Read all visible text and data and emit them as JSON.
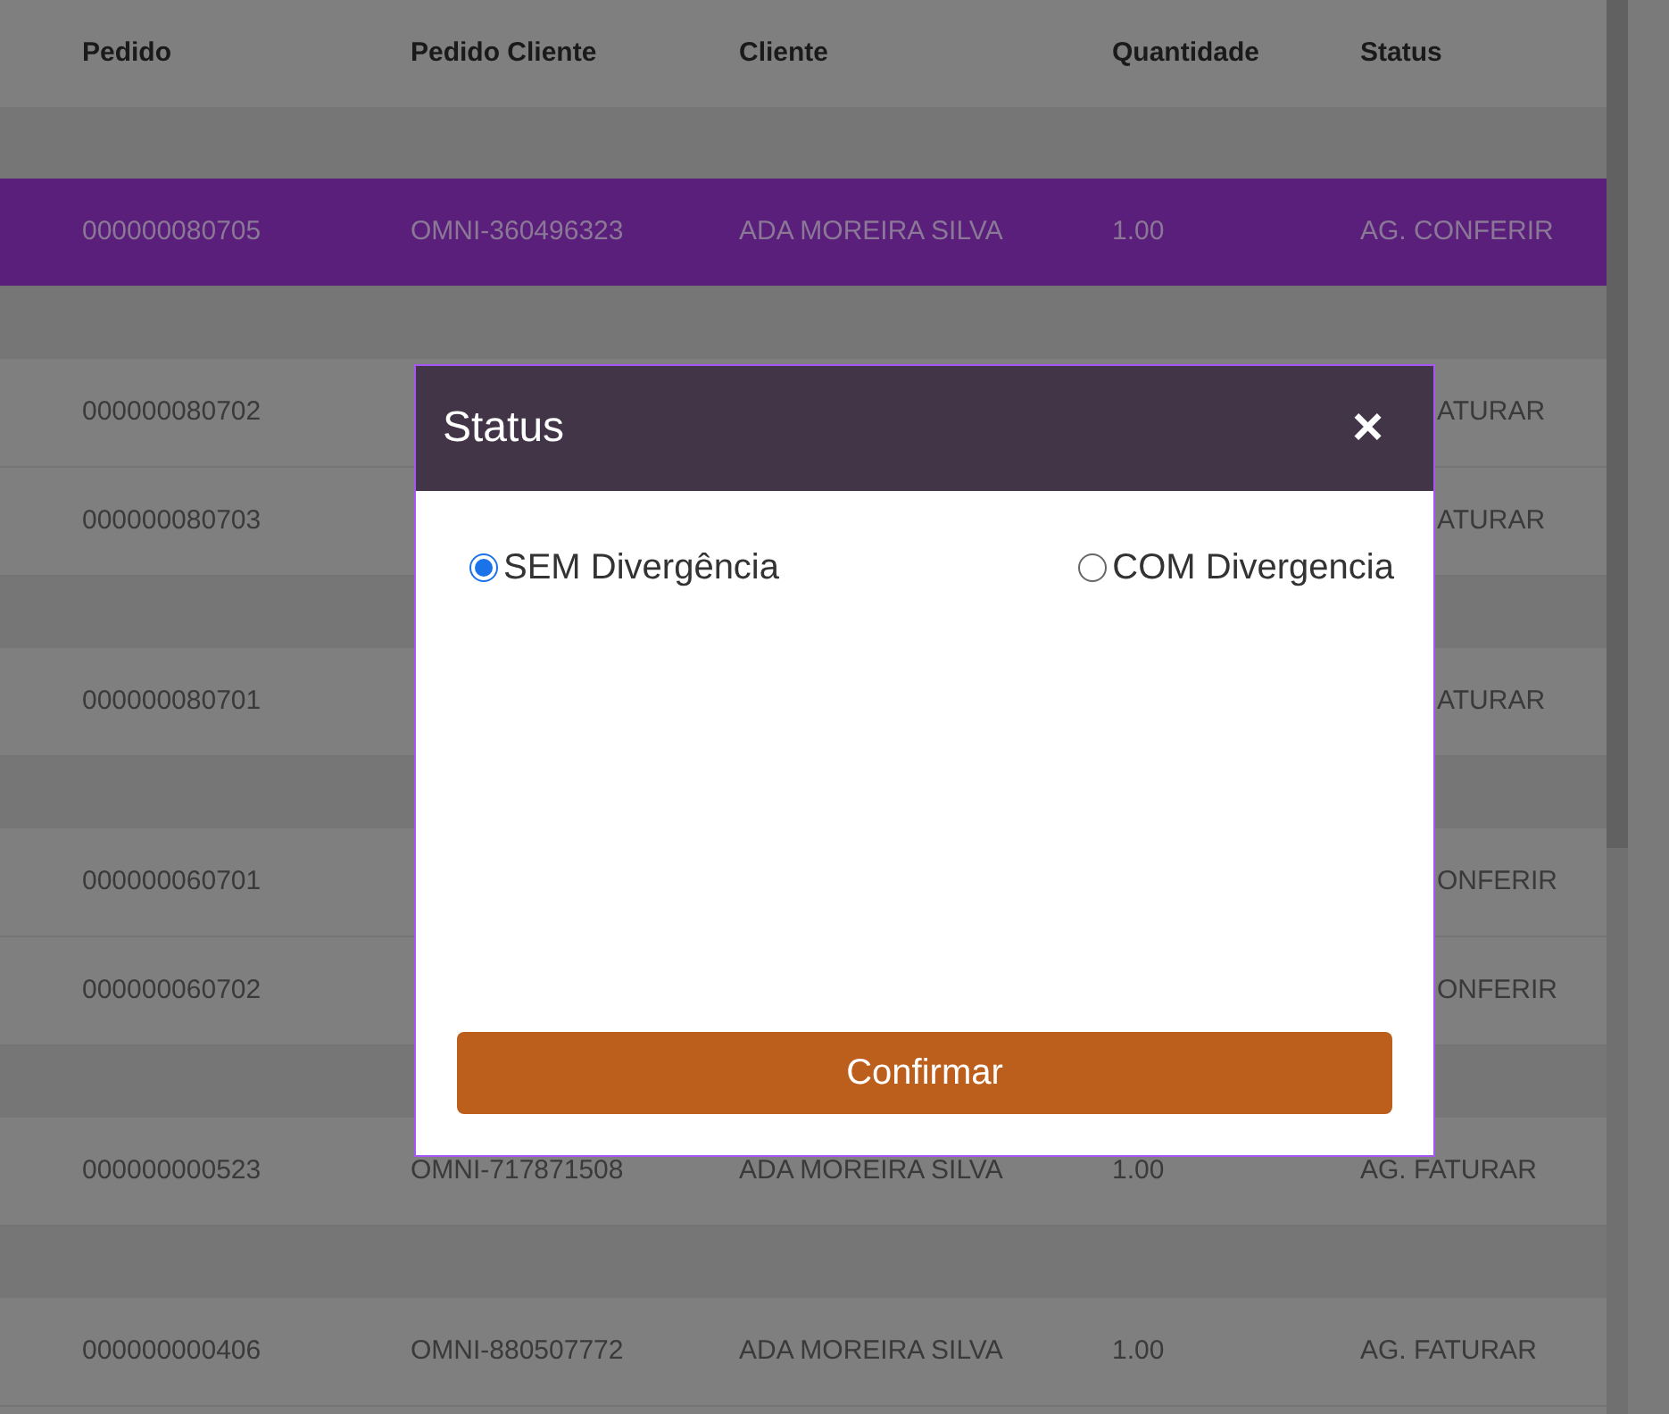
{
  "table": {
    "columns": [
      "Pedido",
      "Pedido Cliente",
      "Cliente",
      "Quantidade",
      "Status"
    ],
    "groups": [
      {
        "rows": [
          {
            "pedido": "000000080705",
            "pedido_cliente": "OMNI-360496323",
            "cliente": "ADA MOREIRA SILVA",
            "quantidade": "1.00",
            "status": "AG. CONFERIR",
            "selected": true
          }
        ]
      },
      {
        "rows": [
          {
            "pedido": "000000080702",
            "status_fragment": "ATURAR",
            "selected": false
          },
          {
            "pedido": "000000080703",
            "status_fragment": "ATURAR",
            "selected": false
          }
        ]
      },
      {
        "rows": [
          {
            "pedido": "000000080701",
            "status_fragment": "ATURAR",
            "selected": false
          }
        ]
      },
      {
        "rows": [
          {
            "pedido": "000000060701",
            "status_fragment": "ONFERIR",
            "selected": false
          },
          {
            "pedido": "000000060702",
            "status_fragment": "ONFERIR",
            "selected": false
          }
        ]
      },
      {
        "rows": [
          {
            "pedido": "000000000523",
            "pedido_cliente": "OMNI-717871508",
            "cliente": "ADA MOREIRA SILVA",
            "quantidade": "1.00",
            "status": "AG. FATURAR",
            "selected": false
          }
        ]
      },
      {
        "rows": [
          {
            "pedido": "000000000406",
            "pedido_cliente": "OMNI-880507772",
            "cliente": "ADA MOREIRA SILVA",
            "quantidade": "1.00",
            "status": "AG. FATURAR",
            "selected": false
          }
        ]
      }
    ]
  },
  "dialog": {
    "title": "Status",
    "close": "×",
    "options": [
      {
        "label": "SEM Divergência",
        "selected": true
      },
      {
        "label": "COM Divergencia",
        "selected": false
      }
    ],
    "confirm": "Confirmar"
  }
}
